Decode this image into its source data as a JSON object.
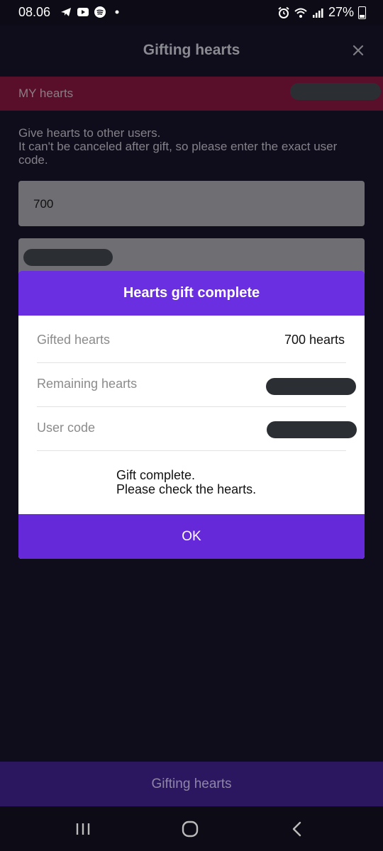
{
  "status_bar": {
    "time": "08.06",
    "battery": "27%",
    "icons": [
      "telegram-icon",
      "youtube-icon",
      "spotify-icon",
      "dot-icon",
      "alarm-icon",
      "wifi-icon",
      "signal-icon",
      "battery-icon"
    ]
  },
  "header": {
    "title": "Gifting hearts",
    "close_icon": "close-icon"
  },
  "my_hearts": {
    "label": "MY hearts"
  },
  "form": {
    "info": "Give hearts to other users.\n It can't be canceled after gift, so please enter the exact user code.",
    "amount_value": "700"
  },
  "modal": {
    "title": "Hearts gift complete",
    "rows": [
      {
        "label": "Gifted hearts",
        "value": "700 hearts"
      },
      {
        "label": "Remaining hearts",
        "value": ""
      },
      {
        "label": "User code",
        "value": ""
      }
    ],
    "message": "Gift complete.\nPlease check the hearts.",
    "ok_label": "OK"
  },
  "bottom_button": {
    "label": "Gifting hearts"
  },
  "nav": {
    "icons": [
      "recent-apps-icon",
      "home-icon",
      "back-icon"
    ]
  },
  "colors": {
    "modal_header": "#6a2fe0",
    "ok_button": "#6629d9",
    "my_hearts_bar": "#590f2a",
    "background": "#0f0c1b"
  }
}
